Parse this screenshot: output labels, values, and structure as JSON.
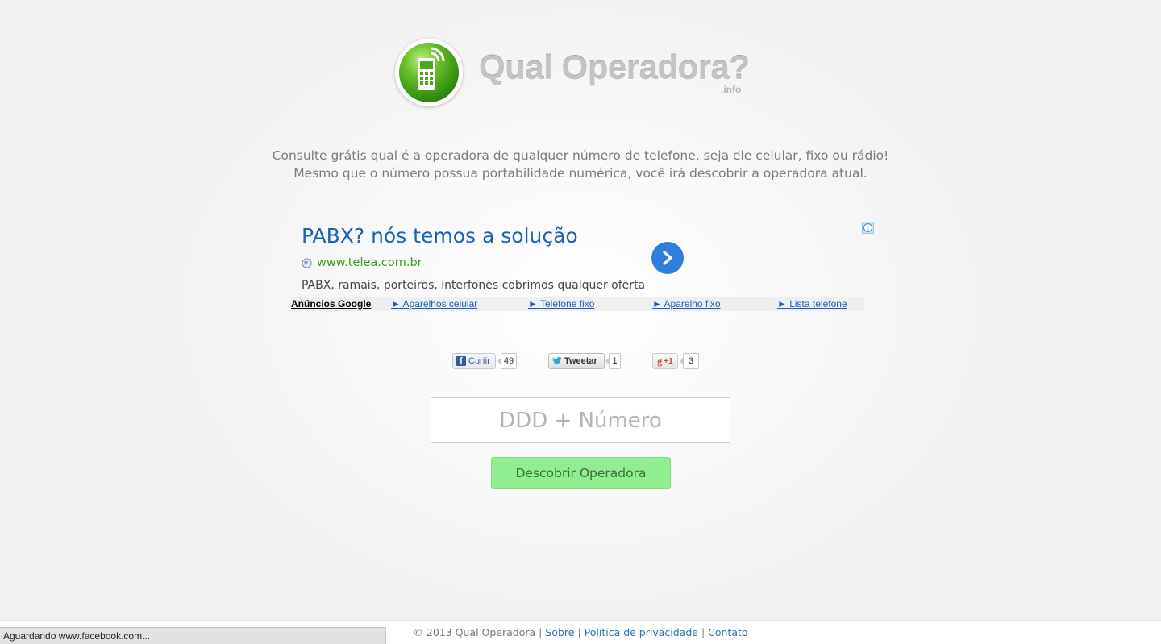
{
  "logo": {
    "title": "Qual Operadora?",
    "suffix": ".info",
    "icon": "cellphone-signal-icon"
  },
  "description": {
    "line1": "Consulte grátis qual é a operadora de qualquer número de telefone, seja ele celular, fixo ou rádio!",
    "line2": "Mesmo que o número possua portabilidade numérica, você irá descobrir a operadora atual."
  },
  "ad": {
    "title": "PABX? nós temos a solução",
    "url": "www.telea.com.br",
    "body": "PABX, ramais, porteiros, interfones cobrimos qualquer oferta"
  },
  "ad_links": {
    "label": "Anúncios Google",
    "items": [
      "► Aparelhos celular",
      "► Telefone fixo",
      "► Aparelho fixo",
      "► Lista telefone"
    ]
  },
  "social": {
    "facebook": {
      "label": "Curtir",
      "count": "49"
    },
    "twitter": {
      "label": "Tweetar",
      "count": "1"
    },
    "gplus": {
      "label": "+1",
      "count": "3"
    }
  },
  "form": {
    "placeholder": "DDD + Número",
    "button": "Descobrir Operadora"
  },
  "footer": {
    "copyright": "© 2013 Qual Operadora",
    "sep": "|",
    "links": [
      "Sobre",
      "Política de privacidade",
      "Contato"
    ]
  },
  "status": "Aguardando www.facebook.com...",
  "colors": {
    "accent_green": "#90ee90",
    "link_blue": "#1a63b8",
    "ad_url_green": "#3b9b1f"
  }
}
